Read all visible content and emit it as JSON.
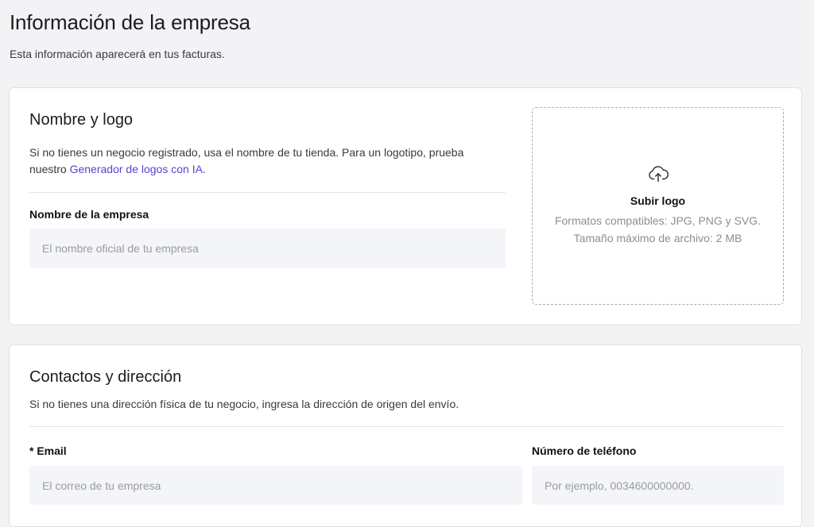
{
  "header": {
    "title": "Información de la empresa",
    "subtitle": "Esta información aparecerá en tus facturas."
  },
  "name_logo": {
    "title": "Nombre y logo",
    "description_prefix": "Si no tienes un negocio registrado, usa el nombre de tu tienda. Para un logotipo, prueba nuestro ",
    "link_label": "Generador de logos con IA",
    "description_suffix": ".",
    "company_name_label": "Nombre de la empresa",
    "company_name_value": "",
    "company_name_placeholder": "El nombre oficial de tu empresa",
    "upload": {
      "icon": "cloud-upload-icon",
      "title": "Subir logo",
      "formats": "Formatos compatibles: JPG, PNG y SVG.",
      "max_size": "Tamaño máximo de archivo: 2 MB"
    }
  },
  "contacts": {
    "title": "Contactos y dirección",
    "description": "Si no tienes una dirección física de tu negocio, ingresa la dirección de origen del envío.",
    "email_label": "* Email",
    "email_value": "",
    "email_placeholder": "El correo de tu empresa",
    "phone_label": "Número de teléfono",
    "phone_value": "",
    "phone_placeholder": "Por ejemplo, 0034600000000."
  },
  "colors": {
    "link": "#5b3fd6",
    "input_background": "#f4f5f9",
    "page_background": "#f3f3f5"
  }
}
